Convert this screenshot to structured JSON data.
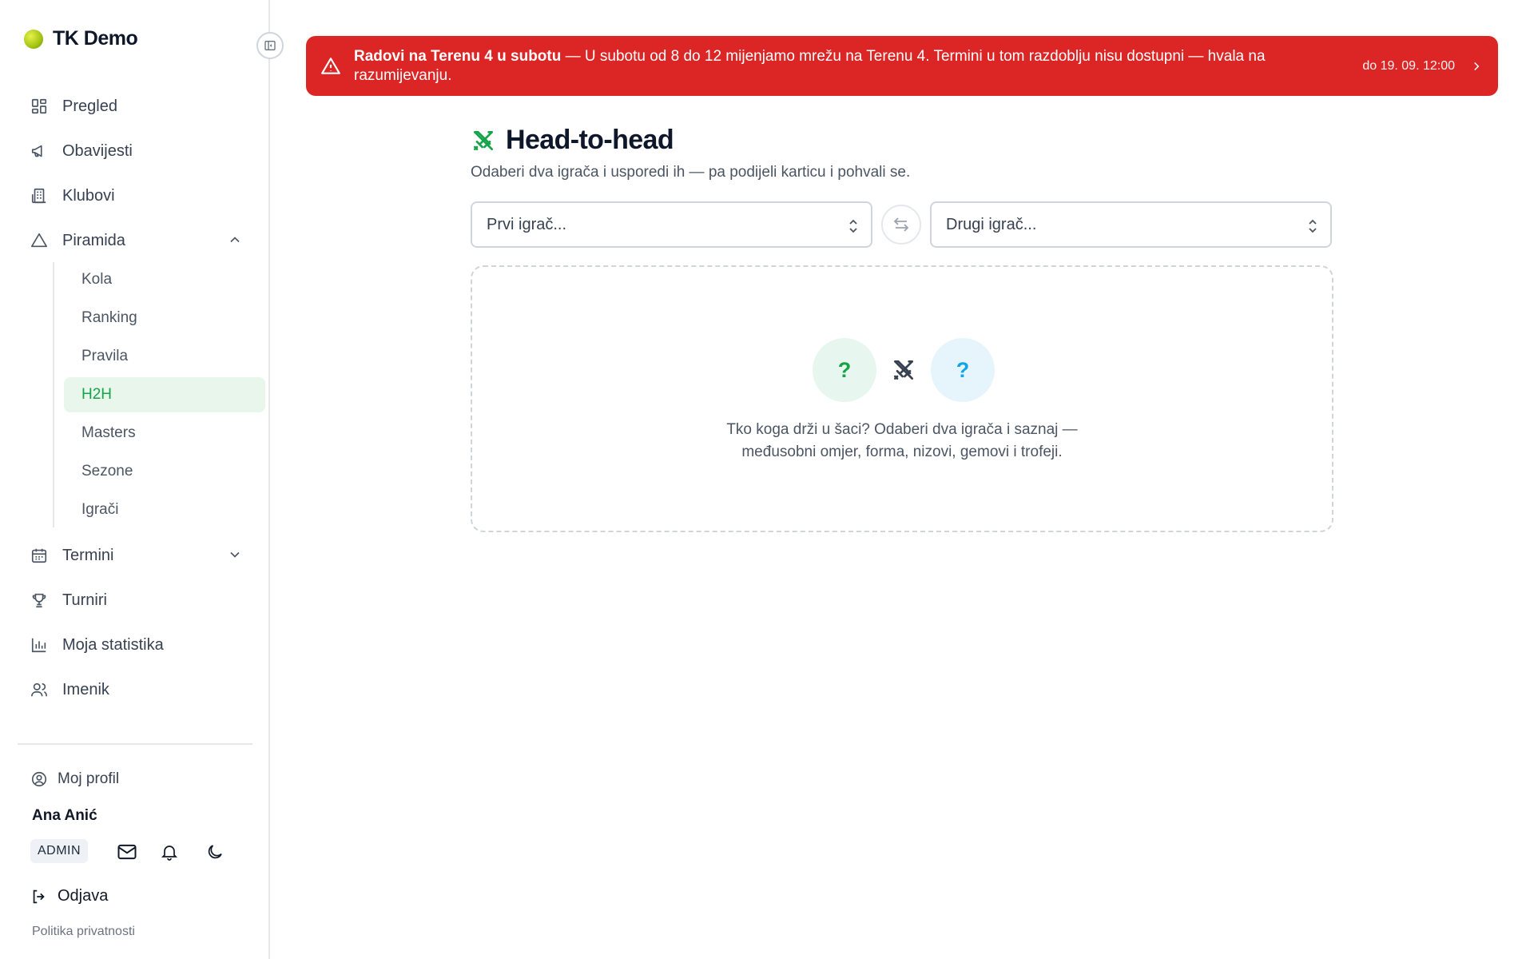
{
  "brand": {
    "name": "TK Demo"
  },
  "nav": {
    "items": [
      {
        "key": "pregled",
        "label": "Pregled",
        "icon": "dashboard-grid-icon"
      },
      {
        "key": "obavijesti",
        "label": "Obavijesti",
        "icon": "megaphone-icon"
      },
      {
        "key": "klubovi",
        "label": "Klubovi",
        "icon": "building-icon"
      },
      {
        "key": "piramida",
        "label": "Piramida",
        "icon": "triangle-icon",
        "expanded": true
      },
      {
        "key": "termini",
        "label": "Termini",
        "icon": "calendar-icon",
        "expanded": false
      },
      {
        "key": "turniri",
        "label": "Turniri",
        "icon": "trophy-icon"
      },
      {
        "key": "statistika",
        "label": "Moja statistika",
        "icon": "bar-chart-icon"
      },
      {
        "key": "imenik",
        "label": "Imenik",
        "icon": "users-icon"
      }
    ],
    "piramida_sub": [
      "Kola",
      "Ranking",
      "Pravila",
      "H2H",
      "Masters",
      "Sezone",
      "Igrači"
    ],
    "active_sub": "H2H"
  },
  "user": {
    "profile_label": "Moj profil",
    "name": "Ana Anić",
    "role": "ADMIN",
    "logout_label": "Odjava",
    "privacy_label": "Politika privatnosti"
  },
  "alert": {
    "title": "Radovi na Terenu 4 u subotu",
    "message": " — U subotu od 8 do 12 mijenjamo mrežu na Terenu 4. Termini u tom razdoblju nisu dostupni — hvala na razumijevanju.",
    "until": "do 19. 09. 12:00",
    "color": "#dc2626"
  },
  "page": {
    "title": "Head-to-head",
    "subtitle": "Odaberi dva igrača i usporedi ih — pa podijeli karticu i pohvali se.",
    "player1_placeholder": "Prvi igrač...",
    "player2_placeholder": "Drugi igrač...",
    "empty_left": "?",
    "empty_right": "?",
    "empty_line1": "Tko koga drži u šaci? Odaberi dva igrača i saznaj —",
    "empty_line2": "međusobni omjer, forma, nizovi, gemovi i trofeji.",
    "accent": "#16a34a"
  }
}
